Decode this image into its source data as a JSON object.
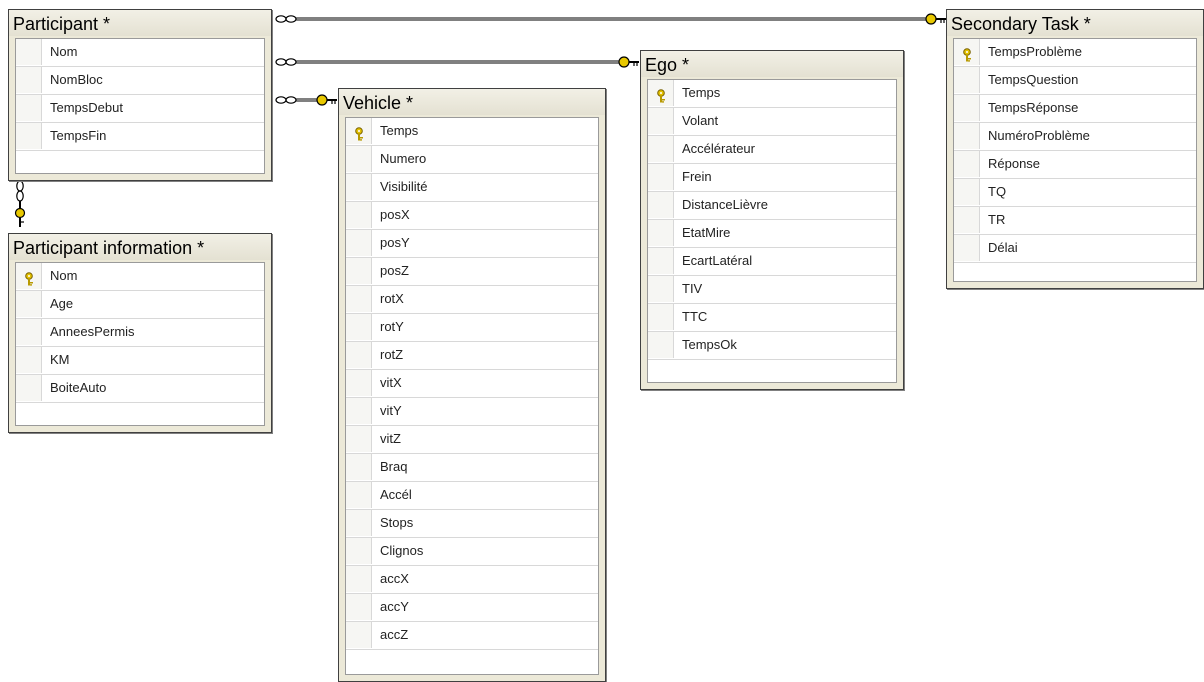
{
  "tables": {
    "participant": {
      "title": "Participant *",
      "columns": [
        {
          "name": "Nom",
          "pk": false
        },
        {
          "name": "NomBloc",
          "pk": false
        },
        {
          "name": "TempsDebut",
          "pk": false
        },
        {
          "name": "TempsFin",
          "pk": false
        }
      ]
    },
    "participant_info": {
      "title": "Participant information *",
      "columns": [
        {
          "name": "Nom",
          "pk": true
        },
        {
          "name": "Age",
          "pk": false
        },
        {
          "name": "AnneesPermis",
          "pk": false
        },
        {
          "name": "KM",
          "pk": false
        },
        {
          "name": "BoiteAuto",
          "pk": false
        }
      ]
    },
    "vehicle": {
      "title": "Vehicle *",
      "columns": [
        {
          "name": "Temps",
          "pk": true
        },
        {
          "name": "Numero",
          "pk": false
        },
        {
          "name": "Visibilité",
          "pk": false
        },
        {
          "name": "posX",
          "pk": false
        },
        {
          "name": "posY",
          "pk": false
        },
        {
          "name": "posZ",
          "pk": false
        },
        {
          "name": "rotX",
          "pk": false
        },
        {
          "name": "rotY",
          "pk": false
        },
        {
          "name": "rotZ",
          "pk": false
        },
        {
          "name": "vitX",
          "pk": false
        },
        {
          "name": "vitY",
          "pk": false
        },
        {
          "name": "vitZ",
          "pk": false
        },
        {
          "name": "Braq",
          "pk": false
        },
        {
          "name": "Accél",
          "pk": false
        },
        {
          "name": "Stops",
          "pk": false
        },
        {
          "name": "Clignos",
          "pk": false
        },
        {
          "name": "accX",
          "pk": false
        },
        {
          "name": "accY",
          "pk": false
        },
        {
          "name": "accZ",
          "pk": false
        }
      ]
    },
    "ego": {
      "title": "Ego *",
      "columns": [
        {
          "name": "Temps",
          "pk": true
        },
        {
          "name": "Volant",
          "pk": false
        },
        {
          "name": "Accélérateur",
          "pk": false
        },
        {
          "name": "Frein",
          "pk": false
        },
        {
          "name": "DistanceLièvre",
          "pk": false
        },
        {
          "name": "EtatMire",
          "pk": false
        },
        {
          "name": "EcartLatéral",
          "pk": false
        },
        {
          "name": "TIV",
          "pk": false
        },
        {
          "name": "TTC",
          "pk": false
        },
        {
          "name": "TempsOk",
          "pk": false
        }
      ]
    },
    "secondary": {
      "title": "Secondary Task *",
      "columns": [
        {
          "name": "TempsProblème",
          "pk": true
        },
        {
          "name": "TempsQuestion",
          "pk": false
        },
        {
          "name": "TempsRéponse",
          "pk": false
        },
        {
          "name": "NuméroProblème",
          "pk": false
        },
        {
          "name": "Réponse",
          "pk": false
        },
        {
          "name": "TQ",
          "pk": false
        },
        {
          "name": "TR",
          "pk": false
        },
        {
          "name": "Délai",
          "pk": false
        }
      ]
    }
  },
  "colors": {
    "table_frame": "#ece9d8",
    "key_gold": "#d4b000",
    "relationship_line": "#000000"
  }
}
